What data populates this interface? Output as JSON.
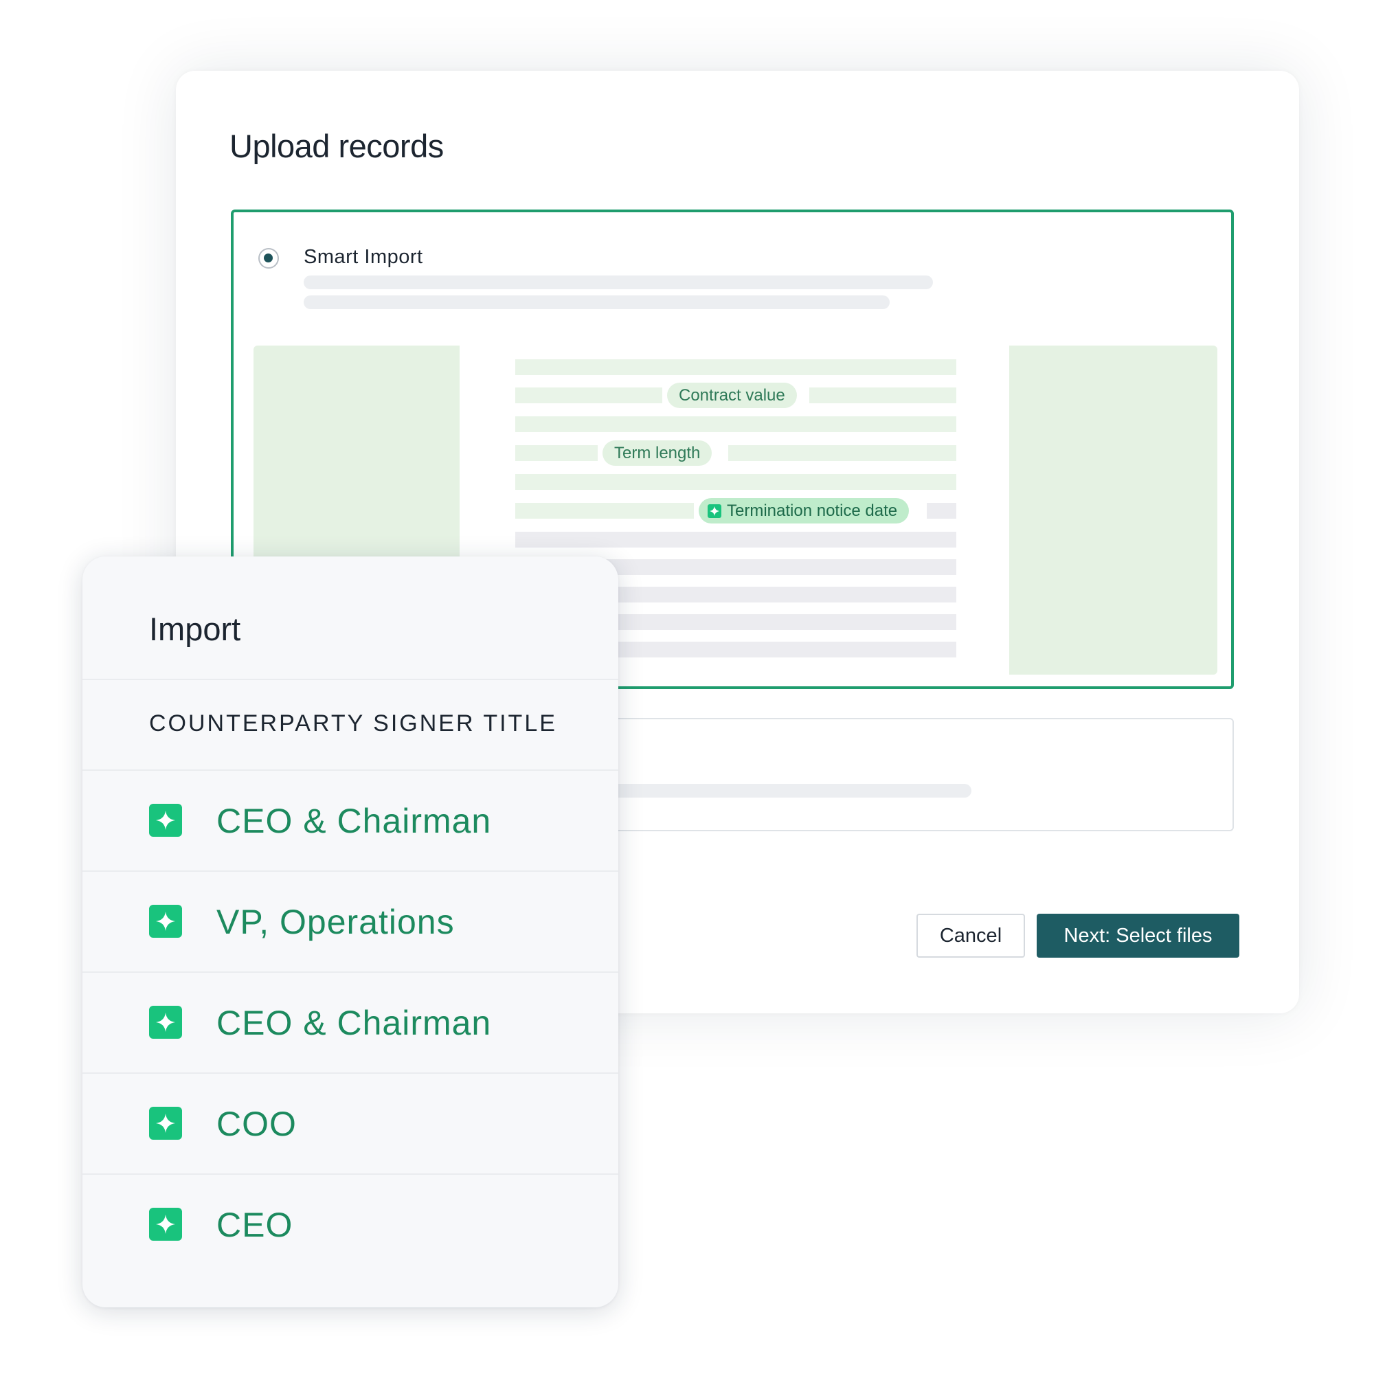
{
  "modal": {
    "title": "Upload records",
    "smart_import": {
      "label": "Smart Import",
      "selected": true,
      "preview_tags": [
        "Contract value",
        "Term length",
        "Termination notice date"
      ]
    },
    "actions": {
      "cancel_label": "Cancel",
      "next_label": "Next: Select files"
    }
  },
  "import_panel": {
    "title": "Import",
    "column_header": "COUNTERPARTY SIGNER TITLE",
    "rows": [
      "CEO & Chairman",
      "VP, Operations",
      "CEO & Chairman",
      "COO",
      "CEO"
    ]
  },
  "colors": {
    "accent_green": "#1f9d6e",
    "ai_icon_green": "#19c37d",
    "value_text_green": "#1c8a5e",
    "primary_button": "#1e5c63"
  },
  "icons": {
    "ai_extracted": "sparkle-icon",
    "radio": "radio-selected-icon"
  }
}
